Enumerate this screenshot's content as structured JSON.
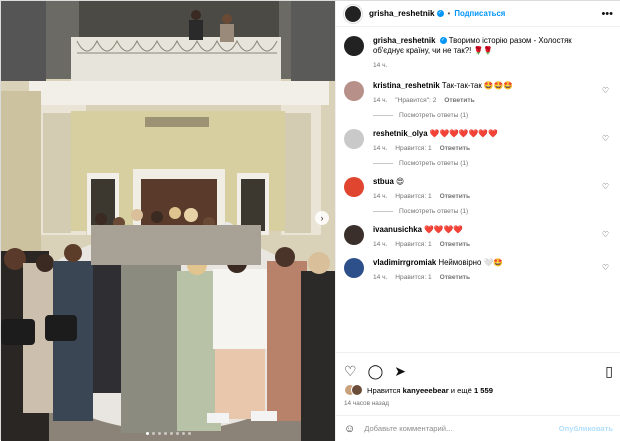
{
  "post": {
    "author": "grisha_reshetnik",
    "follow_label": "Подписаться",
    "caption": "Творимо історію разом - Холостяк об'єднує країну, чи не так?!",
    "caption_emoji": "🌹🌹",
    "caption_time": "14 ч."
  },
  "comments": [
    {
      "user": "kristina_reshetnik",
      "text": "Так-так-так 🤩🤩🤩",
      "time": "14 ч.",
      "likes": "\"Нравится\": 2",
      "reply": "Ответить",
      "view_replies": "Посмотреть ответы (1)",
      "avatar_color": "#b8908a"
    },
    {
      "user": "reshetnik_olya",
      "text": "❤️❤️❤️❤️❤️❤️❤️",
      "time": "14 ч.",
      "likes": "Нравится: 1",
      "reply": "Ответить",
      "view_replies": "Посмотреть ответы (1)",
      "avatar_color": "#c9c9c9"
    },
    {
      "user": "stbua",
      "text": "😍",
      "time": "14 ч.",
      "likes": "Нравится: 1",
      "reply": "Ответить",
      "view_replies": "Посмотреть ответы (1)",
      "avatar_color": "#e0452f"
    },
    {
      "user": "ivaanusichka",
      "text": "❤️❤️❤️❤️",
      "time": "14 ч.",
      "likes": "Нравится: 1",
      "reply": "Ответить",
      "view_replies": "",
      "avatar_color": "#3a2f2a"
    },
    {
      "user": "vladimirrgromiak",
      "text": "Неймовірно 🤍🤩",
      "time": "14 ч.",
      "likes": "Нравится: 1",
      "reply": "Ответить",
      "view_replies": "",
      "avatar_color": "#2d4f8a"
    }
  ],
  "likes_line": {
    "prefix": "Нравится",
    "user": "kanyeeebear",
    "middle": "и ещё",
    "count": "1 559"
  },
  "time_ago": "14 часов назад",
  "add_comment": {
    "placeholder": "Добавьте комментарий...",
    "publish_label": "Опубликовать"
  },
  "icons": {
    "like": "heart-icon",
    "comment": "comment-icon",
    "share": "share-icon",
    "save": "bookmark-icon",
    "emoji": "emoji-icon",
    "more": "more-icon"
  },
  "colors": {
    "accent": "#0095f6",
    "publish_disabled": "#b2dffc",
    "meta": "#737373"
  }
}
